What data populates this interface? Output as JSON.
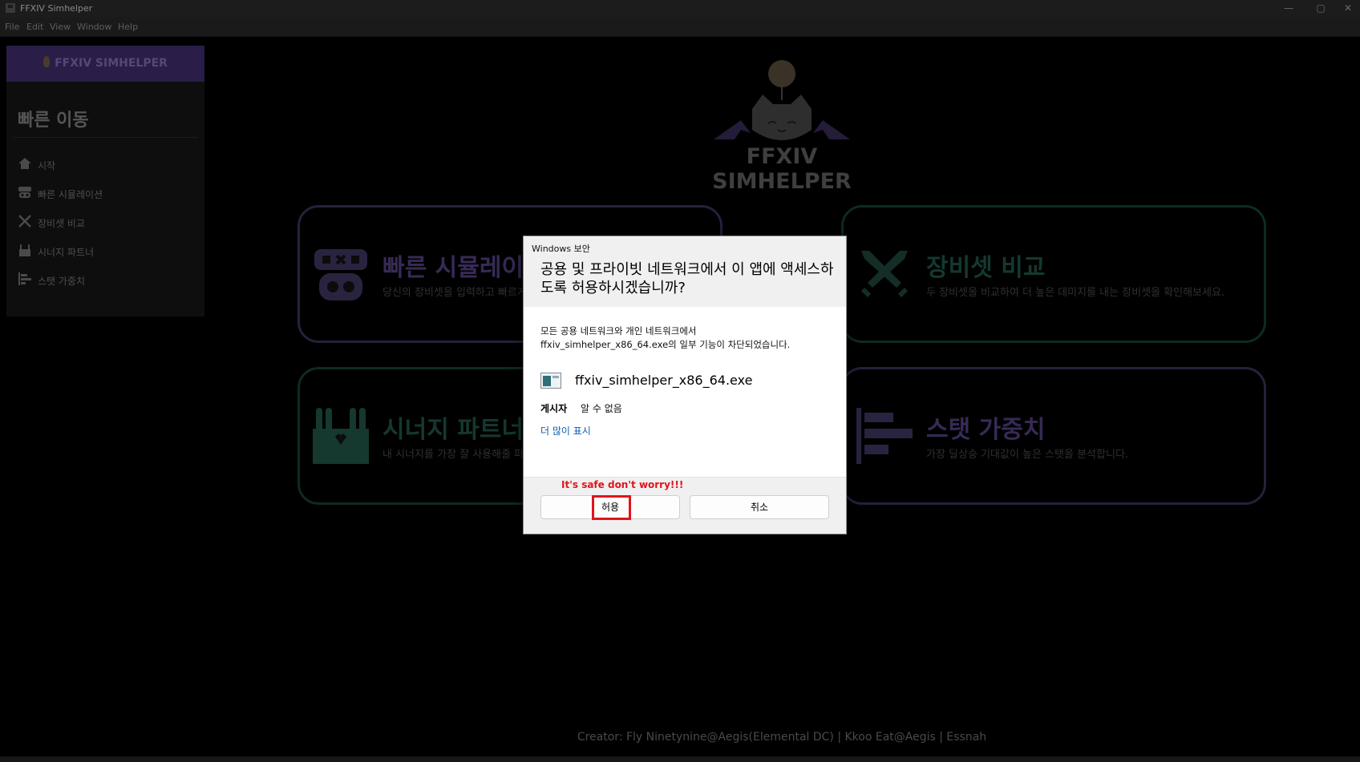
{
  "window": {
    "title": "FFXIV Simhelper",
    "menu": [
      "File",
      "Edit",
      "View",
      "Window",
      "Help"
    ]
  },
  "sidebar": {
    "brand": "FFXIV SIMHELPER",
    "heading": "빠른 이동",
    "items": [
      {
        "label": "시작",
        "icon": "home-icon"
      },
      {
        "label": "빠른 시뮬레이션",
        "icon": "robot-icon"
      },
      {
        "label": "장비셋 비교",
        "icon": "swords-icon"
      },
      {
        "label": "시너지 파트너",
        "icon": "bunnies-icon"
      },
      {
        "label": "스탯 가중치",
        "icon": "bar-chart-icon"
      }
    ]
  },
  "logo_text": "FFXIV SIMHELPER",
  "cards": [
    {
      "title": "빠른 시뮬레이션",
      "desc": "당신의 장비셋을 입력하고 빠르게 시뮬레이션을 돌려보세요.",
      "icon": "robot-icon",
      "accent": "#372a55"
    },
    {
      "title": "장비셋 비교",
      "desc": "두 장비셋을 비교하여 더 높은 데미지를 내는 장비셋을 확인해보세요.",
      "icon": "swords-icon",
      "accent": "#15382f"
    },
    {
      "title": "시너지 파트너",
      "desc": "내 시너지를 가장 잘 사용해줄 파트너를 찾아보세요.",
      "icon": "bunnies-icon",
      "accent": "#15382f"
    },
    {
      "title": "스탯 가중치",
      "desc": "가장 딜상승 기대값이 높은 스탯을 분석합니다.",
      "icon": "bar-chart-icon",
      "accent": "#372a55"
    }
  ],
  "footer": "Creator: Fly Ninetynine@Aegis(Elemental DC) | Kkoo Eat@Aegis | Essnah",
  "dialog": {
    "window_title": "Windows 보안",
    "question": "공용 및 프라이빗 네트워크에서 이 앱에 액세스하도록 허용하시겠습니까?",
    "message_line1": "모든 공용 네트워크와 개인 네트워크에서",
    "message_line2": "ffxiv_simhelper_x86_64.exe의 일부 기능이 차단되었습니다.",
    "exe_name": "ffxiv_simhelper_x86_64.exe",
    "publisher_label": "게시자",
    "publisher_value": "알 수 없음",
    "more_link": "더 많이 표시",
    "annotation": "It's safe don't worry!!!",
    "allow_button": "허용",
    "cancel_button": "취소"
  }
}
